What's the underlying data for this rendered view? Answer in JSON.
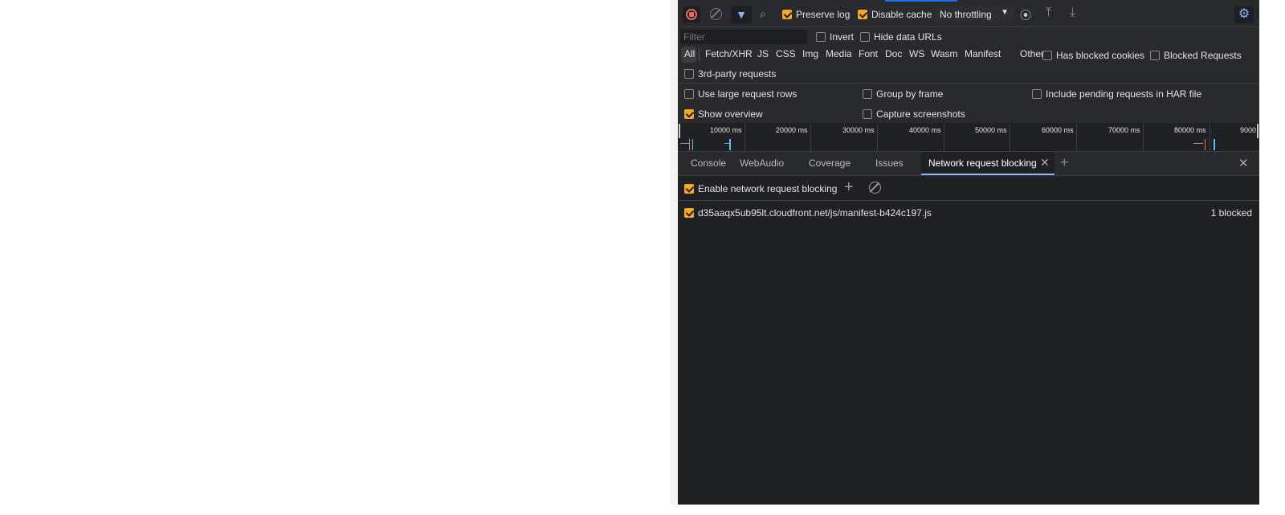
{
  "toolbar": {
    "record_icon": "stop-record-icon",
    "clear_icon": "clear-icon",
    "filter_icon": "filter-icon",
    "search_icon": "search-icon",
    "preserve_log": {
      "label": "Preserve log",
      "checked": true
    },
    "disable_cache": {
      "label": "Disable cache",
      "checked": true
    },
    "throttling": "No throttling",
    "settings_icon": "gear-icon"
  },
  "filter_bar": {
    "placeholder": "Filter",
    "invert": {
      "label": "Invert",
      "checked": false
    },
    "hide_data_urls": {
      "label": "Hide data URLs",
      "checked": false
    },
    "types": [
      "All",
      "Fetch/XHR",
      "JS",
      "CSS",
      "Img",
      "Media",
      "Font",
      "Doc",
      "WS",
      "Wasm",
      "Manifest",
      "Other"
    ],
    "selected_type": "All",
    "has_blocked_cookies": {
      "label": "Has blocked cookies",
      "checked": false
    },
    "blocked_requests": {
      "label": "Blocked Requests",
      "checked": false
    },
    "third_party": {
      "label": "3rd-party requests",
      "checked": false
    }
  },
  "settings": {
    "large_rows": {
      "label": "Use large request rows",
      "checked": false
    },
    "group_by_frame": {
      "label": "Group by frame",
      "checked": false
    },
    "include_pending": {
      "label": "Include pending requests in HAR file",
      "checked": false
    },
    "show_overview": {
      "label": "Show overview",
      "checked": true
    },
    "capture_screenshots": {
      "label": "Capture screenshots",
      "checked": false
    }
  },
  "overview": {
    "ticks": [
      "10000 ms",
      "20000 ms",
      "30000 ms",
      "40000 ms",
      "50000 ms",
      "60000 ms",
      "70000 ms",
      "80000 ms",
      "9000"
    ]
  },
  "drawer": {
    "tabs": [
      "Console",
      "WebAudio",
      "Coverage",
      "Issues",
      "Network request blocking"
    ],
    "active_tab": "Network request blocking",
    "enable_blocking": {
      "label": "Enable network request blocking",
      "checked": true
    },
    "patterns": [
      {
        "url": "d35aaqx5ub95lt.cloudfront.net/js/manifest-b424c197.js",
        "checked": true,
        "count": "1 blocked"
      }
    ]
  },
  "colors": {
    "accent": "#f9a825",
    "active_tab_underline": "#8ab4f8",
    "record": "#e46962"
  }
}
